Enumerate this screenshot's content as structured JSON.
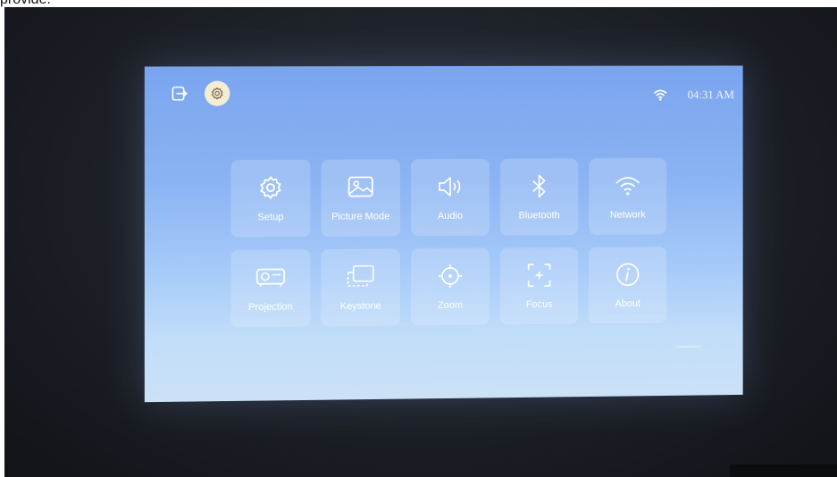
{
  "caption": "provide.",
  "status": {
    "exit_icon": "exit-icon",
    "settings_icon": "gear-icon",
    "wifi_icon": "wifi-icon",
    "time": "04:31 AM"
  },
  "menu": {
    "tiles": [
      {
        "label": "Setup",
        "icon": "gear-icon"
      },
      {
        "label": "Picture Mode",
        "icon": "image-icon"
      },
      {
        "label": "Audio",
        "icon": "speaker-icon"
      },
      {
        "label": "Bluetooth",
        "icon": "bluetooth-icon"
      },
      {
        "label": "Network",
        "icon": "wifi-icon"
      },
      {
        "label": "Projection",
        "icon": "projector-icon"
      },
      {
        "label": "Keystone",
        "icon": "keystone-icon"
      },
      {
        "label": "Zoom",
        "icon": "zoom-target-icon"
      },
      {
        "label": "Focus",
        "icon": "focus-icon"
      },
      {
        "label": "About",
        "icon": "info-icon"
      }
    ]
  },
  "colors": {
    "screen_top": "#7aa4ee",
    "screen_bottom": "#cbe1f6",
    "tile_bg": "rgba(255,255,255,0.18)",
    "badge_bg": "#f5ecd4",
    "room_dark": "#1c1f26"
  }
}
